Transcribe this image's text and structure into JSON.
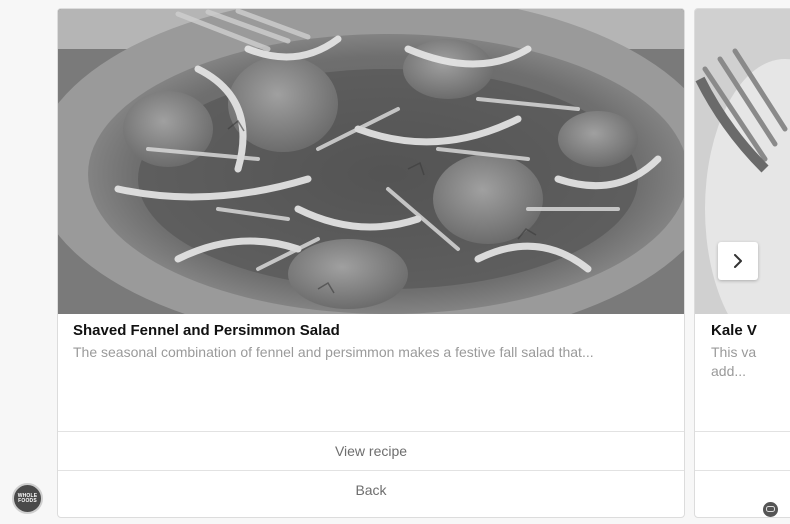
{
  "carousel": {
    "cards": [
      {
        "image_alt": "Shaved fennel and persimmon salad on a pewter plate",
        "title": "Shaved Fennel and Persimmon Salad",
        "description": "The seasonal combination of fennel and persimmon makes a festive fall salad that...",
        "buttons": [
          "View recipe",
          "Back"
        ]
      },
      {
        "image_alt": "Plate with fork",
        "title": "Kale V",
        "description": "This va\nadd...",
        "buttons": [
          "",
          ""
        ]
      }
    ],
    "next_icon": "chevron-right-icon"
  },
  "brand": {
    "avatar_text": "WHOLE FOODS",
    "avatar_icon": "whole-foods-logo"
  },
  "footer": {
    "corner_icon": "chat-bubble-icon"
  }
}
